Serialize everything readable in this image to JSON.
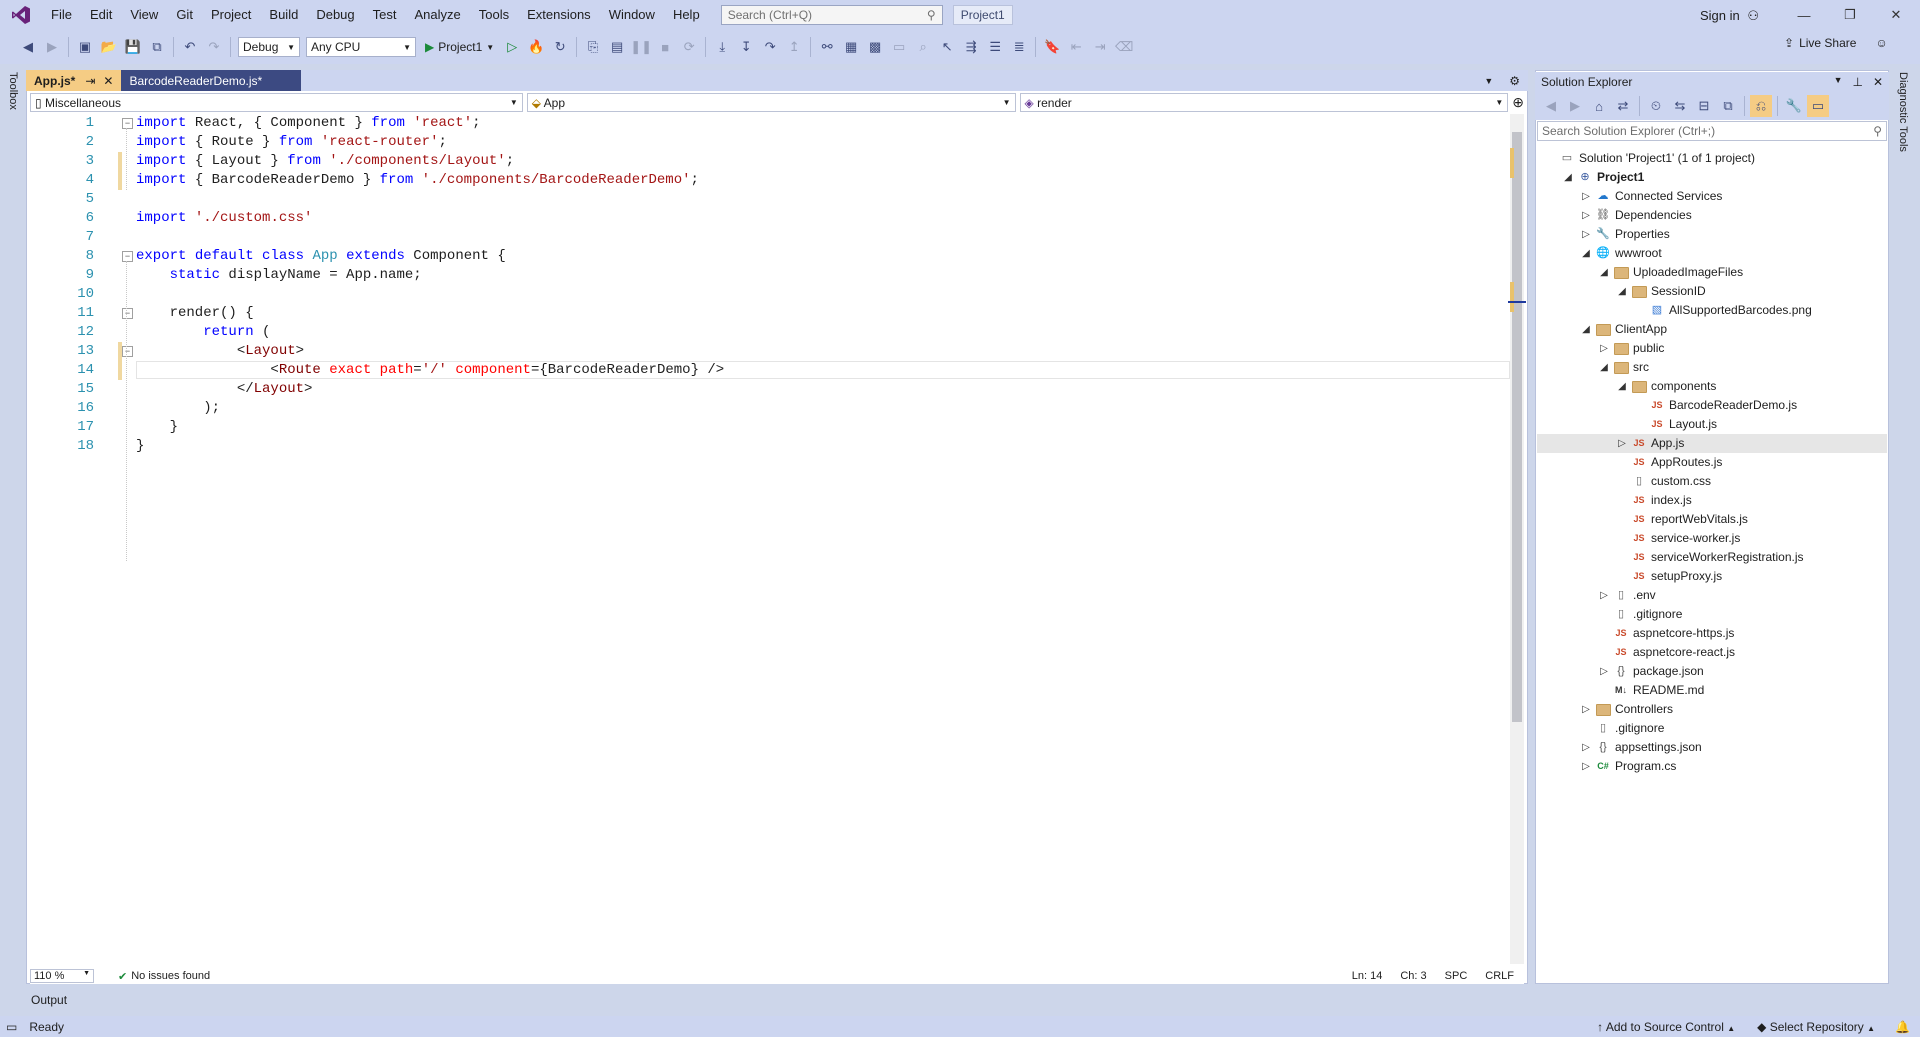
{
  "menubar": {
    "items": [
      "File",
      "Edit",
      "View",
      "Git",
      "Project",
      "Build",
      "Debug",
      "Test",
      "Analyze",
      "Tools",
      "Extensions",
      "Window",
      "Help"
    ],
    "search_placeholder": "Search (Ctrl+Q)",
    "project_badge": "Project1",
    "sign_in": "Sign in"
  },
  "toolbar": {
    "config": "Debug",
    "platform": "Any CPU",
    "run_target": "Project1",
    "live_share": "Live Share"
  },
  "left_strip": {
    "toolbox": "Toolbox"
  },
  "right_strip": {
    "diagnostic": "Diagnostic Tools"
  },
  "editor": {
    "tabs": [
      {
        "label": "App.js*",
        "pin": "⇥",
        "close": "✕"
      },
      {
        "label": "BarcodeReaderDemo.js*"
      }
    ],
    "nav": {
      "project": "Miscellaneous",
      "scope": "App",
      "member": "render"
    },
    "lines": [
      {
        "n": "1",
        "tokens": [
          [
            "kw",
            "import"
          ],
          [
            "p",
            " React, { Component } "
          ],
          [
            "kw",
            "from"
          ],
          [
            "p",
            " "
          ],
          [
            "str",
            "'react'"
          ],
          [
            "p",
            ";"
          ]
        ]
      },
      {
        "n": "2",
        "tokens": [
          [
            "kw",
            "import"
          ],
          [
            "p",
            " { Route } "
          ],
          [
            "kw",
            "from"
          ],
          [
            "p",
            " "
          ],
          [
            "str",
            "'react-router'"
          ],
          [
            "p",
            ";"
          ]
        ]
      },
      {
        "n": "3",
        "tokens": [
          [
            "kw",
            "import"
          ],
          [
            "p",
            " { Layout } "
          ],
          [
            "kw",
            "from"
          ],
          [
            "p",
            " "
          ],
          [
            "str",
            "'./components/Layout'"
          ],
          [
            "p",
            ";"
          ]
        ]
      },
      {
        "n": "4",
        "tokens": [
          [
            "kw",
            "import"
          ],
          [
            "p",
            " { BarcodeReaderDemo } "
          ],
          [
            "kw",
            "from"
          ],
          [
            "p",
            " "
          ],
          [
            "str",
            "'./components/BarcodeReaderDemo'"
          ],
          [
            "p",
            ";"
          ]
        ]
      },
      {
        "n": "5",
        "tokens": []
      },
      {
        "n": "6",
        "tokens": [
          [
            "kw",
            "import"
          ],
          [
            "p",
            " "
          ],
          [
            "str",
            "'./custom.css'"
          ]
        ]
      },
      {
        "n": "7",
        "tokens": []
      },
      {
        "n": "8",
        "tokens": [
          [
            "kw",
            "export"
          ],
          [
            "p",
            " "
          ],
          [
            "kw",
            "default"
          ],
          [
            "p",
            " "
          ],
          [
            "kw",
            "class"
          ],
          [
            "p",
            " "
          ],
          [
            "cls",
            "App"
          ],
          [
            "p",
            " "
          ],
          [
            "kw",
            "extends"
          ],
          [
            "p",
            " Component {"
          ]
        ]
      },
      {
        "n": "9",
        "tokens": [
          [
            "p",
            "    "
          ],
          [
            "kw",
            "static"
          ],
          [
            "p",
            " displayName = App.name;"
          ]
        ]
      },
      {
        "n": "10",
        "tokens": []
      },
      {
        "n": "11",
        "tokens": [
          [
            "p",
            "    render() {"
          ]
        ]
      },
      {
        "n": "12",
        "tokens": [
          [
            "p",
            "        "
          ],
          [
            "kw",
            "return"
          ],
          [
            "p",
            " ("
          ]
        ]
      },
      {
        "n": "13",
        "tokens": [
          [
            "p",
            "            <"
          ],
          [
            "tag",
            "Layout"
          ],
          [
            "p",
            ">"
          ]
        ]
      },
      {
        "n": "14",
        "tokens": [
          [
            "p",
            "                <"
          ],
          [
            "tag",
            "Route"
          ],
          [
            "p",
            " "
          ],
          [
            "attr",
            "exact"
          ],
          [
            "p",
            " "
          ],
          [
            "attr",
            "path"
          ],
          [
            "p",
            "="
          ],
          [
            "str",
            "'/'"
          ],
          [
            "p",
            " "
          ],
          [
            "attr",
            "component"
          ],
          [
            "p",
            "={BarcodeReaderDemo} />"
          ]
        ]
      },
      {
        "n": "15",
        "tokens": [
          [
            "p",
            "            </"
          ],
          [
            "tag",
            "Layout"
          ],
          [
            "p",
            ">"
          ]
        ]
      },
      {
        "n": "16",
        "tokens": [
          [
            "p",
            "        );"
          ]
        ]
      },
      {
        "n": "17",
        "tokens": [
          [
            "p",
            "    }"
          ]
        ]
      },
      {
        "n": "18",
        "tokens": [
          [
            "p",
            "}"
          ]
        ]
      }
    ],
    "status": {
      "zoom": "110 %",
      "issues": "No issues found",
      "ln": "Ln: 14",
      "ch": "Ch: 3",
      "spc": "SPC",
      "crlf": "CRLF"
    }
  },
  "output": {
    "label": "Output"
  },
  "solution_explorer": {
    "title": "Solution Explorer",
    "search_placeholder": "Search Solution Explorer (Ctrl+;)",
    "items": [
      {
        "label": "Solution 'Project1' (1 of 1 project)",
        "depth": 0,
        "expander": "",
        "icon": "solution"
      },
      {
        "label": "Project1",
        "depth": 1,
        "expander": "open",
        "icon": "project",
        "bold": true
      },
      {
        "label": "Connected Services",
        "depth": 2,
        "expander": "closed",
        "icon": "services"
      },
      {
        "label": "Dependencies",
        "depth": 2,
        "expander": "closed",
        "icon": "deps"
      },
      {
        "label": "Properties",
        "depth": 2,
        "expander": "closed",
        "icon": "props"
      },
      {
        "label": "wwwroot",
        "depth": 2,
        "expander": "open",
        "icon": "globe"
      },
      {
        "label": "UploadedImageFiles",
        "depth": 3,
        "expander": "open",
        "icon": "folder"
      },
      {
        "label": "SessionID",
        "depth": 4,
        "expander": "open",
        "icon": "folder"
      },
      {
        "label": "AllSupportedBarcodes.png",
        "depth": 5,
        "expander": "",
        "icon": "image"
      },
      {
        "label": "ClientApp",
        "depth": 2,
        "expander": "open",
        "icon": "folder"
      },
      {
        "label": "public",
        "depth": 3,
        "expander": "closed",
        "icon": "folder"
      },
      {
        "label": "src",
        "depth": 3,
        "expander": "open",
        "icon": "folder"
      },
      {
        "label": "components",
        "depth": 4,
        "expander": "open",
        "icon": "folder"
      },
      {
        "label": "BarcodeReaderDemo.js",
        "depth": 5,
        "expander": "",
        "icon": "js"
      },
      {
        "label": "Layout.js",
        "depth": 5,
        "expander": "",
        "icon": "js"
      },
      {
        "label": "App.js",
        "depth": 4,
        "expander": "closed",
        "icon": "js",
        "selected": true
      },
      {
        "label": "AppRoutes.js",
        "depth": 4,
        "expander": "",
        "icon": "js"
      },
      {
        "label": "custom.css",
        "depth": 4,
        "expander": "",
        "icon": "file"
      },
      {
        "label": "index.js",
        "depth": 4,
        "expander": "",
        "icon": "js"
      },
      {
        "label": "reportWebVitals.js",
        "depth": 4,
        "expander": "",
        "icon": "js"
      },
      {
        "label": "service-worker.js",
        "depth": 4,
        "expander": "",
        "icon": "js"
      },
      {
        "label": "serviceWorkerRegistration.js",
        "depth": 4,
        "expander": "",
        "icon": "js"
      },
      {
        "label": "setupProxy.js",
        "depth": 4,
        "expander": "",
        "icon": "js"
      },
      {
        "label": ".env",
        "depth": 3,
        "expander": "closed",
        "icon": "file"
      },
      {
        "label": ".gitignore",
        "depth": 3,
        "expander": "",
        "icon": "file"
      },
      {
        "label": "aspnetcore-https.js",
        "depth": 3,
        "expander": "",
        "icon": "js"
      },
      {
        "label": "aspnetcore-react.js",
        "depth": 3,
        "expander": "",
        "icon": "js"
      },
      {
        "label": "package.json",
        "depth": 3,
        "expander": "closed",
        "icon": "json"
      },
      {
        "label": "README.md",
        "depth": 3,
        "expander": "",
        "icon": "md"
      },
      {
        "label": "Controllers",
        "depth": 2,
        "expander": "closed",
        "icon": "folder"
      },
      {
        "label": ".gitignore",
        "depth": 2,
        "expander": "",
        "icon": "file"
      },
      {
        "label": "appsettings.json",
        "depth": 2,
        "expander": "closed",
        "icon": "json"
      },
      {
        "label": "Program.cs",
        "depth": 2,
        "expander": "closed",
        "icon": "cs"
      }
    ]
  },
  "statusbar": {
    "ready": "Ready",
    "source_control": "Add to Source Control",
    "repository": "Select Repository"
  },
  "colors": {
    "accent": "#68217a",
    "tab_active": "#f5cc84",
    "chrome": "#ccd5f0"
  }
}
